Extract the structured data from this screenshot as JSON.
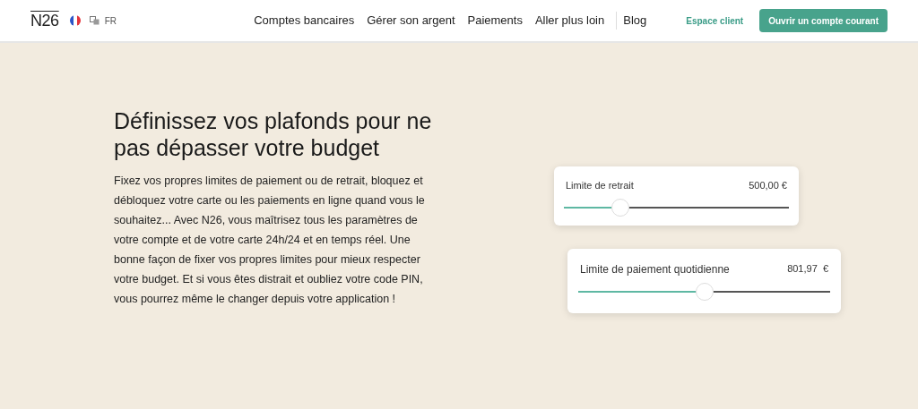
{
  "header": {
    "logo": "N26",
    "language": "FR",
    "nav": [
      {
        "label": "Comptes bancaires"
      },
      {
        "label": "Gérer son argent"
      },
      {
        "label": "Paiements"
      },
      {
        "label": "Aller plus loin"
      },
      {
        "label": "Blog"
      }
    ],
    "login": "Espace client",
    "cta": "Ouvrir un compte courant"
  },
  "hero": {
    "title": "Définissez vos plafonds pour ne pas dépasser votre budget",
    "body": "Fixez vos propres limites de paiement ou de retrait, bloquez et débloquez votre carte ou les paiements en ligne quand vous le souhaitez... Avec N26, vous maîtrisez tous les paramètres de votre compte et de votre carte 24h/24 et en temps réel. Une bonne façon de fixer vos propres limites pour mieux respecter votre budget. Et si vous êtes distrait et oubliez votre code PIN, vous pourrez même le changer depuis votre application !"
  },
  "limits": [
    {
      "label": "Limite de retrait",
      "value": "500,00 €",
      "level": 0.25
    },
    {
      "label": "Limite de paiement quotidienne",
      "value": "801,97  €",
      "level": 0.5
    }
  ]
}
